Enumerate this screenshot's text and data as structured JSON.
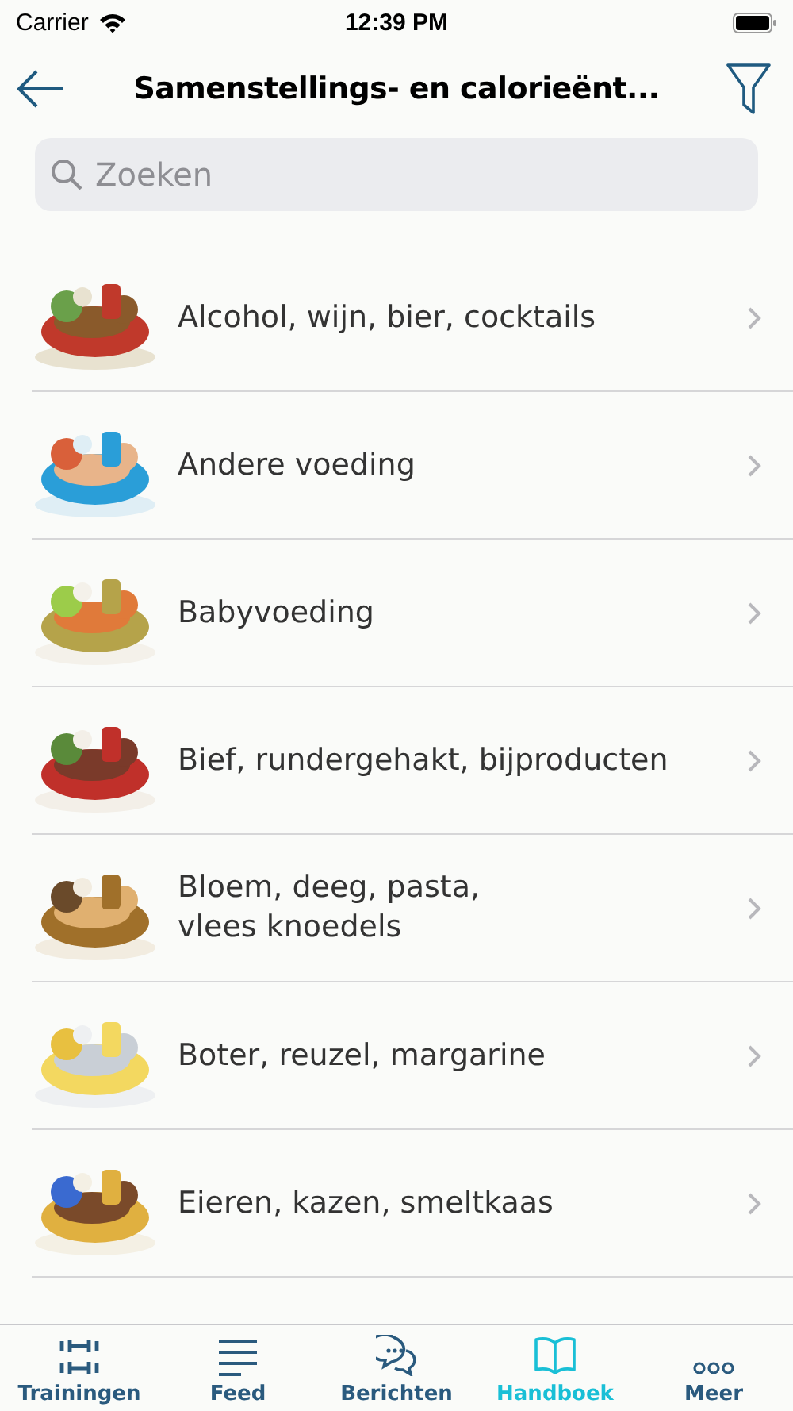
{
  "status_bar": {
    "carrier": "Carrier",
    "time": "12:39 PM"
  },
  "nav": {
    "title": "Samenstellings- en calorieënt..."
  },
  "search": {
    "placeholder": "Zoeken"
  },
  "categories": [
    {
      "label": "Alcohol, wijn, bier, cocktails"
    },
    {
      "label": "Andere voeding"
    },
    {
      "label": "Babyvoeding"
    },
    {
      "label": "Bief, rundergehakt, bijproducten"
    },
    {
      "label": "Bloem, deeg, pasta,\nvlees knoedels"
    },
    {
      "label": "Boter, reuzel, margarine"
    },
    {
      "label": "Eieren, kazen, smeltkaas"
    }
  ],
  "tabs": [
    {
      "label": "Trainingen",
      "kind": "dumbbell",
      "selected": false
    },
    {
      "label": "Feed",
      "kind": "lines",
      "selected": false
    },
    {
      "label": "Berichten",
      "kind": "chat",
      "selected": false
    },
    {
      "label": "Handboek",
      "kind": "book",
      "selected": true
    },
    {
      "label": "Meer",
      "kind": "more",
      "selected": false
    }
  ]
}
